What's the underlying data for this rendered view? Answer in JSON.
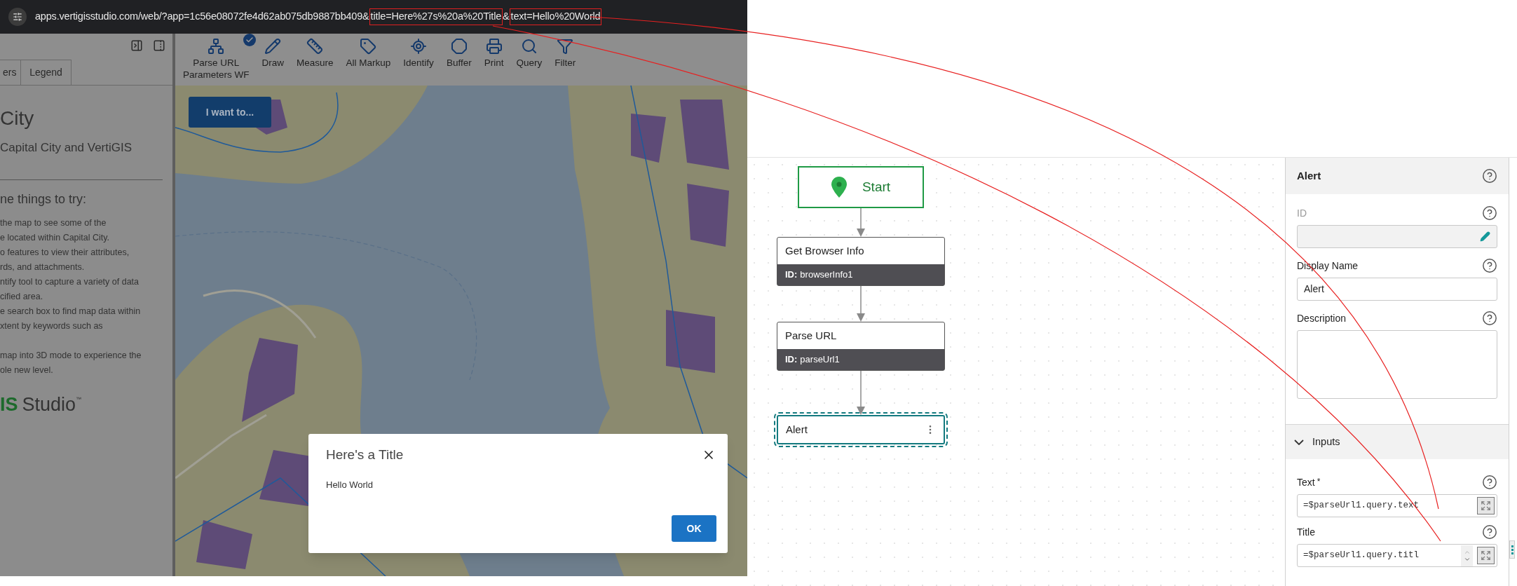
{
  "browser": {
    "url_parts": [
      {
        "text": "apps.vertigisstudio.com/web/?app=1c56e08072fe4d62ab075db9887bb409&",
        "highlighted": false
      },
      {
        "text": "title=Here%27s%20a%20Title",
        "highlighted": true
      },
      {
        "text": "&",
        "highlighted": false
      },
      {
        "text": "text=Hello%20World",
        "highlighted": true
      }
    ]
  },
  "panel": {
    "tabs": [
      "ers",
      "Legend"
    ],
    "title": "City",
    "subtitle": "Capital City and VertiGIS",
    "heading": "ne things to try:",
    "tip_groups": [
      {
        "lines": [
          "the map to see some of the",
          "e located within Capital City.",
          "o features to view their attributes,",
          "rds, and attachments.",
          "ntify tool to capture a variety of data",
          "cified area.",
          "e search box to find map data within",
          "xtent by keywords such as"
        ]
      },
      {
        "lines": [
          "map into 3D mode to experience the",
          "ole new level."
        ]
      }
    ],
    "logo": {
      "accent": "IS",
      "text": "Studio",
      "mark": "™"
    }
  },
  "toolbar": [
    {
      "kind": "hierarchy",
      "label_lines": [
        "Parse URL",
        "Parameters WF"
      ],
      "checked": true
    },
    {
      "kind": "draw",
      "label_lines": [
        "Draw"
      ],
      "checked": false
    },
    {
      "kind": "measure",
      "label_lines": [
        "Measure"
      ],
      "checked": false
    },
    {
      "kind": "markup",
      "label_lines": [
        "All Markup"
      ],
      "checked": false
    },
    {
      "kind": "identify",
      "label_lines": [
        "Identify"
      ],
      "checked": false
    },
    {
      "kind": "buffer",
      "label_lines": [
        "Buffer"
      ],
      "checked": false
    },
    {
      "kind": "print",
      "label_lines": [
        "Print"
      ],
      "checked": false
    },
    {
      "kind": "query",
      "label_lines": [
        "Query"
      ],
      "checked": false
    },
    {
      "kind": "filter",
      "label_lines": [
        "Filter"
      ],
      "checked": false
    }
  ],
  "map": {
    "button": "I want to..."
  },
  "dialog": {
    "title": "Here's a Title",
    "message": "Hello World",
    "button": "OK"
  },
  "workflow": {
    "nodes": [
      {
        "kind": "start",
        "label": "Start",
        "selected": false
      },
      {
        "kind": "activity",
        "label": "Get Browser Info",
        "id_label": "ID:",
        "id": "browserInfo1",
        "selected": false
      },
      {
        "kind": "activity",
        "label": "Parse URL",
        "id_label": "ID:",
        "id": "parseUrl1",
        "selected": false
      },
      {
        "kind": "activity",
        "label": "Alert",
        "selected": true
      }
    ]
  },
  "properties": {
    "title": "Alert",
    "fields": [
      {
        "kind": "input",
        "label": "ID",
        "disabled": true,
        "editable": true
      },
      {
        "kind": "input",
        "label": "Display Name",
        "disabled": false,
        "value": "Alert"
      },
      {
        "kind": "textarea",
        "label": "Description",
        "disabled": false
      }
    ],
    "section": {
      "title": "Inputs",
      "expanded": true,
      "fields": [
        {
          "label": "Text",
          "required_mark": "*",
          "value": "=$parseUrl1.query.text",
          "scrollbar": false
        },
        {
          "label": "Title",
          "value": "=$parseUrl1.query.titl",
          "scrollbar": true
        }
      ]
    }
  }
}
